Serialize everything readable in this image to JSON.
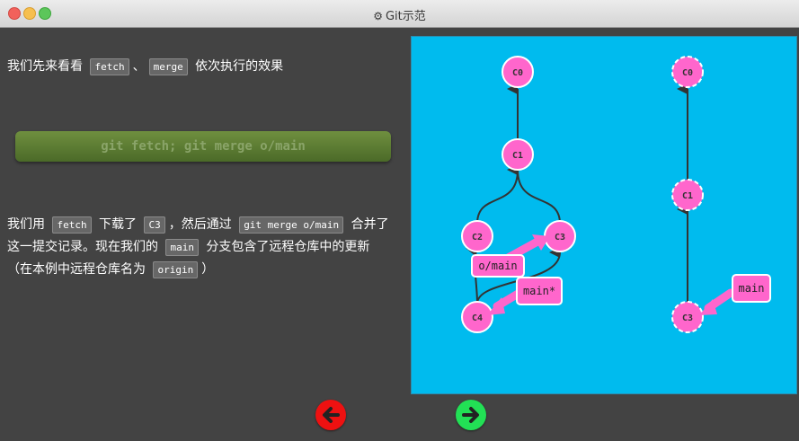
{
  "window": {
    "title": "Git示范"
  },
  "intro": {
    "t1": "我们先来看看",
    "code1": "fetch",
    "t2": "、",
    "code2": "merge",
    "t3": "依次执行的效果"
  },
  "command": "git fetch; git merge o/main",
  "explain": {
    "t1": "我们用",
    "code1": "fetch",
    "t2": "下载了",
    "code2": "C3",
    "t3": "，然后通过",
    "code3": "git merge o/main",
    "t4": "合并了这一提交记录。现在我们的",
    "code4": "main",
    "t5": "分支包含了远程仓库中的更新（在本例中远程仓库名为",
    "code5": "origin",
    "t6": "）"
  },
  "graph": {
    "local_commits": [
      "C0",
      "C1",
      "C2",
      "C3",
      "C4"
    ],
    "local_branches": [
      "o/main",
      "main*"
    ],
    "remote_commits": [
      "C0",
      "C1",
      "C3"
    ],
    "remote_branches": [
      "main"
    ]
  },
  "colors": {
    "commit": "#ff66cc",
    "background": "#00bbee",
    "back": "#ee1111",
    "forward": "#22e055"
  },
  "nav": {
    "back_icon": "arrow-left-icon",
    "forward_icon": "arrow-right-icon"
  }
}
